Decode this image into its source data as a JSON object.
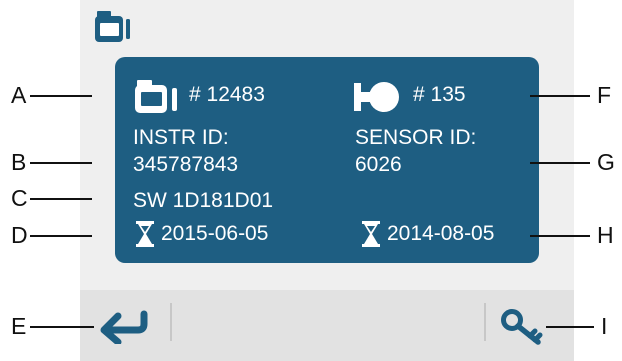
{
  "panel": {
    "instrument_number": "# 12483",
    "instr_id_label": "INSTR ID:",
    "instr_id_value": "345787843",
    "software": "SW 1D181D01",
    "instr_date": "2015-06-05",
    "sensor_number": "# 135",
    "sensor_id_label": "SENSOR ID:",
    "sensor_id_value": "6026",
    "sensor_date": "2014-08-05"
  },
  "callouts": {
    "a": "A",
    "b": "B",
    "c": "C",
    "d": "D",
    "e": "E",
    "f": "F",
    "g": "G",
    "h": "H",
    "i": "I"
  },
  "colors": {
    "panel": "#1e5e82",
    "accent": "#1e5e82",
    "bar": "#e2e2e2",
    "device": "#efefef"
  },
  "icons": {
    "top": "instrument-icon",
    "instrument": "instrument-icon",
    "sensor": "sensor-icon",
    "hourglass": "hourglass-icon",
    "back": "back-arrow-icon",
    "key": "key-icon"
  }
}
